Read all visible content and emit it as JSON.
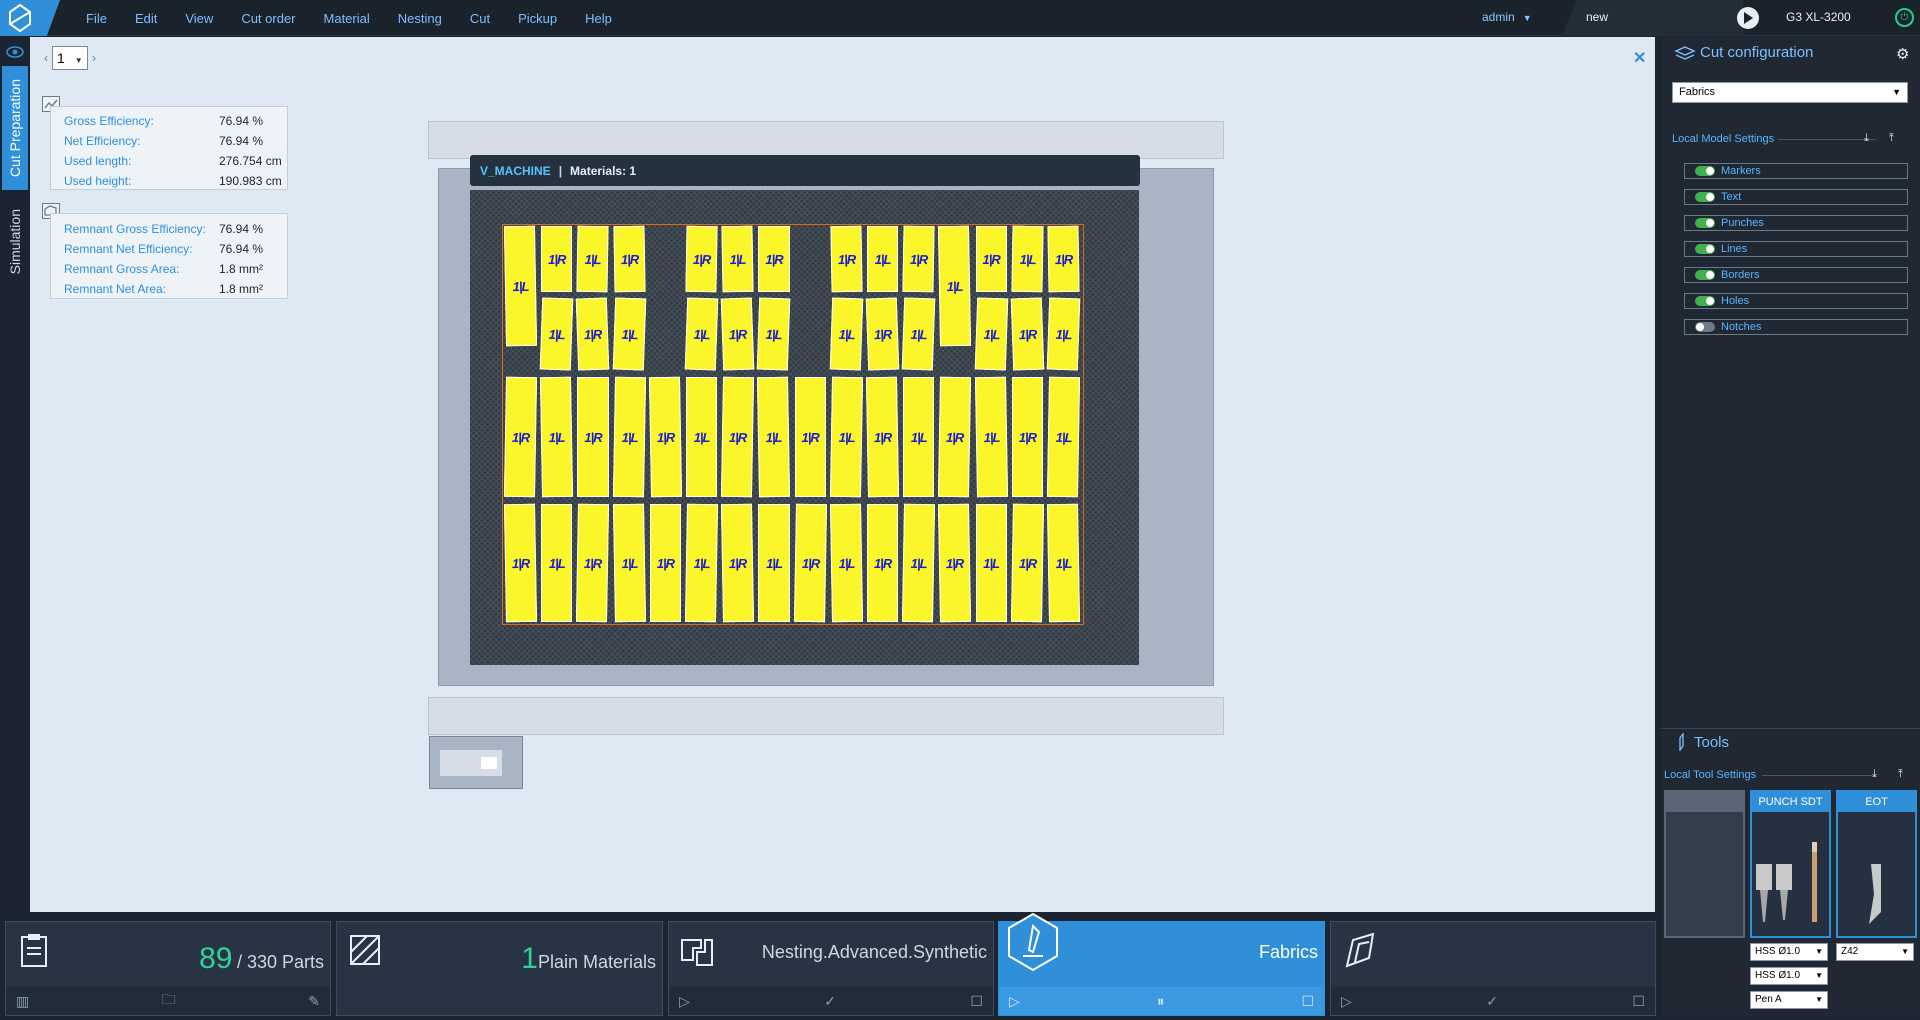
{
  "topbar": {
    "menu": [
      "File",
      "Edit",
      "View",
      "Cut order",
      "Material",
      "Nesting",
      "Cut",
      "Pickup",
      "Help"
    ],
    "user": "admin",
    "job_name": "new",
    "machine": "G3 XL-3200"
  },
  "left_tabs": {
    "cut_preparation": "Cut Preparation",
    "simulation": "Simulation"
  },
  "page_selector": {
    "value": "1"
  },
  "efficiency": {
    "rows": [
      {
        "label": "Gross Efficiency:",
        "value": "76.94 %"
      },
      {
        "label": "Net Efficiency:",
        "value": "76.94 %"
      },
      {
        "label": "Used length:",
        "value": "276.754 cm"
      },
      {
        "label": "Used height:",
        "value": "190.983 cm"
      }
    ]
  },
  "remnant": {
    "rows": [
      {
        "label": "Remnant Gross Efficiency:",
        "value": "76.94 %"
      },
      {
        "label": "Remnant Net Efficiency:",
        "value": "76.94 %"
      },
      {
        "label": "Remnant Gross Area:",
        "value": "1.8 mm²"
      },
      {
        "label": "Remnant Net Area:",
        "value": "1.8 mm²"
      }
    ]
  },
  "material_bar": {
    "name": "V_MACHINE",
    "materials": "Materials: 1"
  },
  "parts": {
    "labels": [
      "1|R",
      "1|L"
    ]
  },
  "cut_config": {
    "title": "Cut configuration",
    "selected": "Fabrics",
    "local_model_settings": "Local Model Settings",
    "toggles": [
      {
        "label": "Markers",
        "on": true
      },
      {
        "label": "Text",
        "on": true
      },
      {
        "label": "Punches",
        "on": true
      },
      {
        "label": "Lines",
        "on": true
      },
      {
        "label": "Borders",
        "on": true
      },
      {
        "label": "Holes",
        "on": true
      },
      {
        "label": "Notches",
        "on": false
      }
    ]
  },
  "tools": {
    "title": "Tools",
    "local_tool_settings": "Local Tool Settings",
    "cards": [
      {
        "label": ""
      },
      {
        "label": "PUNCH SDT"
      },
      {
        "label": "EOT"
      }
    ],
    "selects": [
      "HSS Ø1.0",
      "HSS Ø1.0",
      "Pen A",
      "Z42"
    ]
  },
  "workflow": {
    "cutorder": {
      "count": "89",
      "total": "/ 330 Parts"
    },
    "materials": {
      "count": "1",
      "label": "Plain Materials"
    },
    "nesting": {
      "label": "Nesting.Advanced.Synthetic"
    },
    "cut": {
      "label": "Fabrics"
    }
  },
  "colors": {
    "accent": "#2f8fd8",
    "part_fill": "#fbf62a",
    "part_label": "#1b1bd0",
    "bed": "#333b45",
    "count_green": "#2fd39a"
  }
}
